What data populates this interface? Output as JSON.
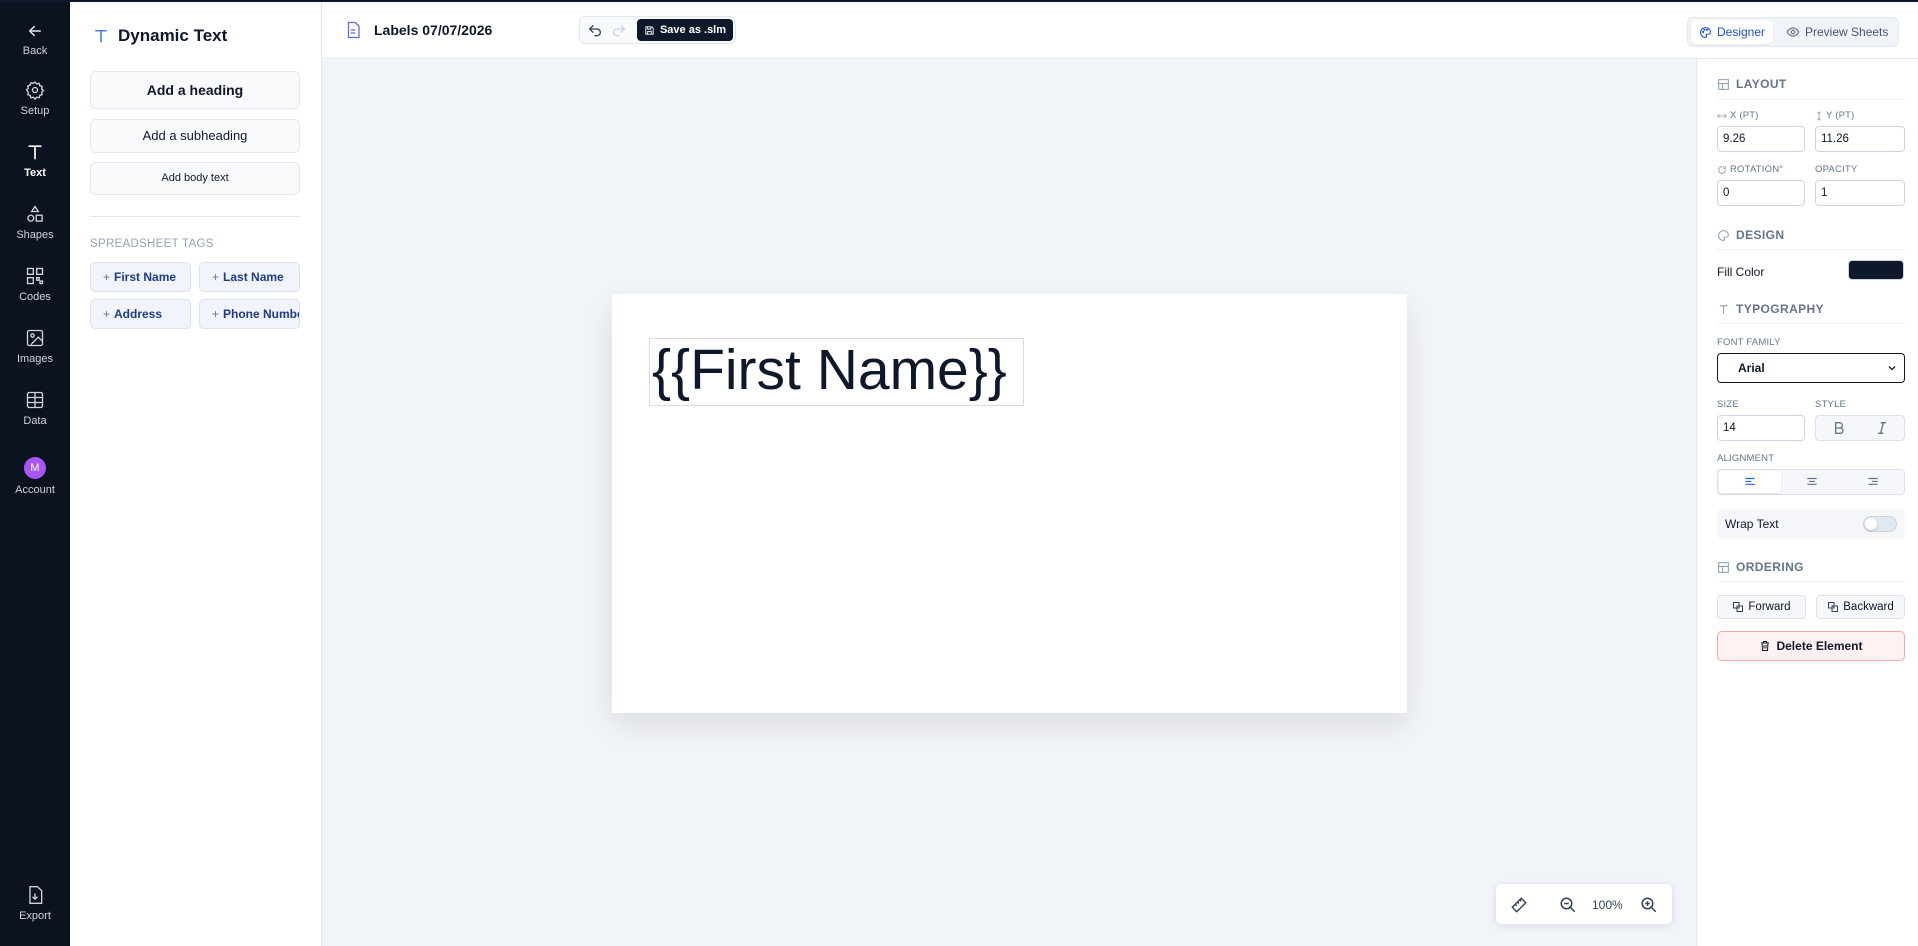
{
  "rail": {
    "back": "Back",
    "setup": "Setup",
    "text": "Text",
    "shapes": "Shapes",
    "codes": "Codes",
    "images": "Images",
    "data": "Data",
    "account": "Account",
    "account_initial": "M",
    "export": "Export"
  },
  "left_panel": {
    "title": "Dynamic Text",
    "add_heading": "Add a heading",
    "add_subheading": "Add a subheading",
    "add_body": "Add body text",
    "tags_section": "SPREADSHEET TAGS",
    "tags": [
      "First Name",
      "Last Name",
      "Address",
      "Phone Number"
    ],
    "tag_prefix": "+"
  },
  "topbar": {
    "doc_title": "Labels 07/07/2026",
    "save_label": "Save as .slm",
    "designer": "Designer",
    "preview": "Preview Sheets"
  },
  "canvas": {
    "text_element": "{{First Name}}",
    "zoom": "100%"
  },
  "props": {
    "layout_title": "LAYOUT",
    "x_label": "X (PT)",
    "x_value": "9.26",
    "y_label": "Y (PT)",
    "y_value": "11.26",
    "rotation_label": "ROTATION°",
    "rotation_value": "0",
    "opacity_label": "OPACITY",
    "opacity_value": "1",
    "design_title": "DESIGN",
    "fill_label": "Fill Color",
    "fill_color": "#0f172a",
    "typography_title": "TYPOGRAPHY",
    "font_family_label": "FONT FAMILY",
    "font_family_value": "Arial",
    "size_label": "SIZE",
    "size_value": "14",
    "style_label": "STYLE",
    "alignment_label": "ALIGNMENT",
    "alignment_selected": "left",
    "wrap_label": "Wrap Text",
    "wrap_on": false,
    "ordering_title": "ORDERING",
    "forward": "Forward",
    "backward": "Backward",
    "delete": "Delete Element"
  },
  "colors": {
    "rail_bg": "#0b1220",
    "accent": "#1d4ed8",
    "dark": "#0f172a",
    "danger_border": "#fca5a5"
  }
}
